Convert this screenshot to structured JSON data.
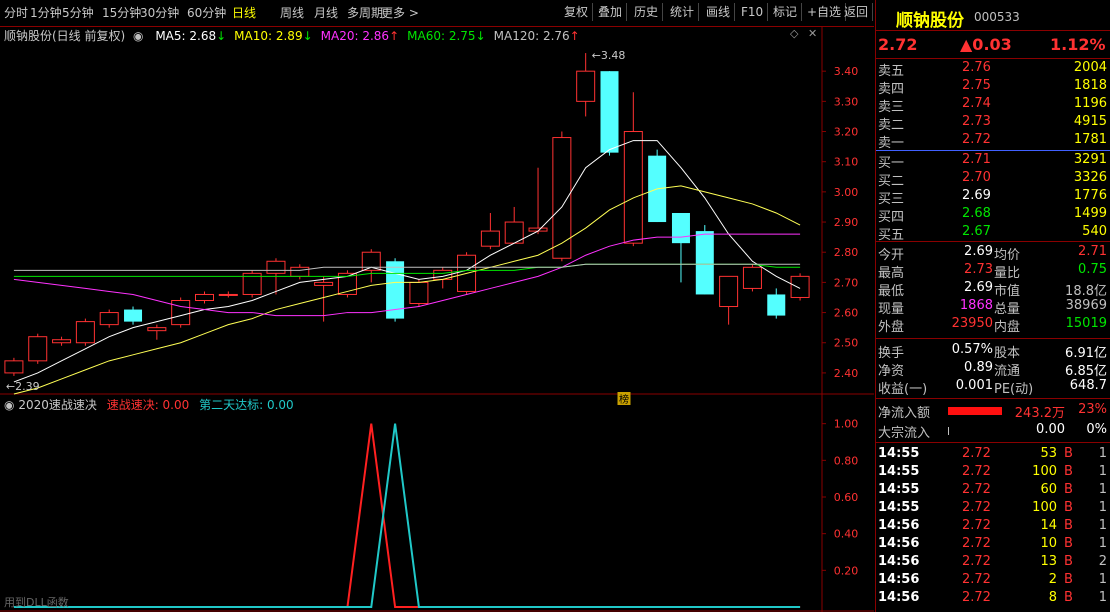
{
  "toolbar": {
    "left": [
      {
        "label": "分时",
        "active": false
      },
      {
        "label": "1分钟",
        "active": false
      },
      {
        "label": "5分钟",
        "active": false
      },
      {
        "label": "15分钟",
        "active": false
      },
      {
        "label": "30分钟",
        "active": false
      },
      {
        "label": "60分钟",
        "active": false
      },
      {
        "label": "日线",
        "active": true
      },
      {
        "label": "周线",
        "active": false
      },
      {
        "label": "月线",
        "active": false
      },
      {
        "label": "多周期",
        "active": false
      },
      {
        "label": "更多 >",
        "active": false
      }
    ],
    "right": [
      "复权",
      "叠加",
      "历史",
      "统计",
      "画线",
      "F10",
      "标记",
      "+自选",
      "返回"
    ]
  },
  "chart_header": {
    "title": "顺钠股份(日线 前复权)",
    "ma": [
      {
        "label": "MA5: 2.68",
        "arrow": "↓",
        "color": "#ffffff",
        "arrow_color": "#00e600"
      },
      {
        "label": "MA10: 2.89",
        "arrow": "↓",
        "color": "#ffff00",
        "arrow_color": "#00e600"
      },
      {
        "label": "MA20: 2.86",
        "arrow": "↑",
        "color": "#ff32ff",
        "arrow_color": "#ff3232"
      },
      {
        "label": "MA60: 2.75",
        "arrow": "↓",
        "color": "#00e600",
        "arrow_color": "#00e600"
      },
      {
        "label": "MA120: 2.76",
        "arrow": "↑",
        "color": "#c0c0c0",
        "arrow_color": "#ff3232"
      }
    ],
    "high_label": "3.48",
    "low_label": "2.39",
    "badge": "榜"
  },
  "indicator_header": {
    "name": "2020速战速决",
    "s1": "速战速决: 0.00",
    "s2": "第二天达标: 0.00",
    "footer": "用到DLL函数"
  },
  "chart_data": [
    {
      "type": "candlestick",
      "ylim": [
        2.35,
        3.5
      ],
      "yticks": [
        "3.40",
        "3.30",
        "3.20",
        "3.10",
        "3.00",
        "2.90",
        "2.80",
        "2.70",
        "2.60",
        "2.50",
        "2.40"
      ],
      "ytick_values": [
        3.4,
        3.3,
        3.2,
        3.1,
        3.0,
        2.9,
        2.8,
        2.7,
        2.6,
        2.5,
        2.4
      ],
      "candles": [
        {
          "o": 2.4,
          "c": 2.44,
          "h": 2.45,
          "l": 2.39
        },
        {
          "o": 2.44,
          "c": 2.52,
          "h": 2.53,
          "l": 2.43
        },
        {
          "o": 2.5,
          "c": 2.51,
          "h": 2.52,
          "l": 2.49
        },
        {
          "o": 2.5,
          "c": 2.57,
          "h": 2.58,
          "l": 2.49
        },
        {
          "o": 2.56,
          "c": 2.6,
          "h": 2.61,
          "l": 2.55
        },
        {
          "o": 2.61,
          "c": 2.57,
          "h": 2.62,
          "l": 2.56
        },
        {
          "o": 2.54,
          "c": 2.55,
          "h": 2.56,
          "l": 2.51
        },
        {
          "o": 2.56,
          "c": 2.64,
          "h": 2.65,
          "l": 2.55
        },
        {
          "o": 2.64,
          "c": 2.66,
          "h": 2.67,
          "l": 2.63
        },
        {
          "o": 2.66,
          "c": 2.66,
          "h": 2.67,
          "l": 2.65
        },
        {
          "o": 2.66,
          "c": 2.73,
          "h": 2.74,
          "l": 2.65
        },
        {
          "o": 2.73,
          "c": 2.77,
          "h": 2.78,
          "l": 2.66
        },
        {
          "o": 2.72,
          "c": 2.75,
          "h": 2.76,
          "l": 2.71
        },
        {
          "o": 2.69,
          "c": 2.7,
          "h": 2.72,
          "l": 2.57
        },
        {
          "o": 2.66,
          "c": 2.73,
          "h": 2.74,
          "l": 2.65
        },
        {
          "o": 2.74,
          "c": 2.8,
          "h": 2.81,
          "l": 2.7
        },
        {
          "o": 2.77,
          "c": 2.58,
          "h": 2.78,
          "l": 2.57
        },
        {
          "o": 2.63,
          "c": 2.7,
          "h": 2.71,
          "l": 2.62
        },
        {
          "o": 2.71,
          "c": 2.74,
          "h": 2.75,
          "l": 2.68
        },
        {
          "o": 2.67,
          "c": 2.79,
          "h": 2.8,
          "l": 2.66
        },
        {
          "o": 2.82,
          "c": 2.87,
          "h": 2.93,
          "l": 2.81
        },
        {
          "o": 2.83,
          "c": 2.9,
          "h": 2.95,
          "l": 2.83
        },
        {
          "o": 2.87,
          "c": 2.88,
          "h": 3.08,
          "l": 2.86
        },
        {
          "o": 2.78,
          "c": 3.18,
          "h": 3.2,
          "l": 2.77
        },
        {
          "o": 3.3,
          "c": 3.4,
          "h": 3.46,
          "l": 3.25
        },
        {
          "o": 3.4,
          "c": 3.13,
          "h": 3.4,
          "l": 3.12
        },
        {
          "o": 2.83,
          "c": 3.2,
          "h": 3.33,
          "l": 2.82
        },
        {
          "o": 3.12,
          "c": 2.9,
          "h": 3.14,
          "l": 2.9
        },
        {
          "o": 2.93,
          "c": 2.83,
          "h": 2.93,
          "l": 2.7
        },
        {
          "o": 2.87,
          "c": 2.66,
          "h": 2.89,
          "l": 2.66
        },
        {
          "o": 2.62,
          "c": 2.72,
          "h": 2.72,
          "l": 2.56
        },
        {
          "o": 2.68,
          "c": 2.75,
          "h": 2.76,
          "l": 2.67
        },
        {
          "o": 2.66,
          "c": 2.59,
          "h": 2.68,
          "l": 2.58
        },
        {
          "o": 2.65,
          "c": 2.72,
          "h": 2.73,
          "l": 2.64
        }
      ],
      "ma5": [
        2.37,
        2.4,
        2.44,
        2.48,
        2.52,
        2.55,
        2.57,
        2.59,
        2.61,
        2.62,
        2.64,
        2.67,
        2.7,
        2.71,
        2.72,
        2.75,
        2.73,
        2.71,
        2.72,
        2.74,
        2.79,
        2.83,
        2.87,
        2.95,
        3.08,
        3.14,
        3.17,
        3.17,
        3.08,
        2.98,
        2.86,
        2.77,
        2.72,
        2.68
      ],
      "ma10": [
        2.33,
        2.35,
        2.38,
        2.41,
        2.44,
        2.46,
        2.48,
        2.5,
        2.53,
        2.56,
        2.58,
        2.61,
        2.63,
        2.65,
        2.67,
        2.69,
        2.7,
        2.7,
        2.71,
        2.73,
        2.75,
        2.77,
        2.79,
        2.83,
        2.88,
        2.94,
        2.98,
        3.01,
        3.02,
        3.0,
        2.98,
        2.96,
        2.93,
        2.89
      ],
      "ma20": [
        2.71,
        2.7,
        2.69,
        2.68,
        2.67,
        2.66,
        2.64,
        2.62,
        2.61,
        2.6,
        2.6,
        2.59,
        2.59,
        2.59,
        2.6,
        2.6,
        2.61,
        2.62,
        2.64,
        2.66,
        2.68,
        2.7,
        2.72,
        2.75,
        2.79,
        2.82,
        2.84,
        2.85,
        2.85,
        2.86,
        2.86,
        2.86,
        2.86,
        2.86
      ],
      "ma60": [
        2.72,
        2.72,
        2.72,
        2.72,
        2.72,
        2.72,
        2.72,
        2.72,
        2.72,
        2.72,
        2.72,
        2.72,
        2.72,
        2.72,
        2.72,
        2.73,
        2.73,
        2.73,
        2.73,
        2.74,
        2.74,
        2.74,
        2.75,
        2.75,
        2.76,
        2.76,
        2.76,
        2.76,
        2.76,
        2.76,
        2.76,
        2.76,
        2.75,
        2.75
      ],
      "ma120": [
        2.74,
        2.74,
        2.74,
        2.74,
        2.74,
        2.74,
        2.74,
        2.74,
        2.74,
        2.74,
        2.74,
        2.74,
        2.74,
        2.75,
        2.75,
        2.75,
        2.75,
        2.75,
        2.75,
        2.75,
        2.75,
        2.75,
        2.75,
        2.75,
        2.76,
        2.76,
        2.76,
        2.76,
        2.76,
        2.76,
        2.76,
        2.76,
        2.76,
        2.76
      ]
    },
    {
      "type": "line",
      "ylim": [
        0,
        1.08
      ],
      "yticks": [
        "1.00",
        "0.80",
        "0.60",
        "0.40",
        "0.20"
      ],
      "ytick_values": [
        1.0,
        0.8,
        0.6,
        0.4,
        0.2
      ],
      "x": [
        0,
        1,
        2,
        3,
        4,
        5,
        6,
        7,
        8,
        9,
        10,
        11,
        12,
        13,
        14,
        15,
        16,
        17,
        18,
        19,
        20,
        21,
        22,
        23,
        24,
        25,
        26,
        27,
        28,
        29,
        30,
        31,
        32,
        33
      ],
      "series": [
        {
          "name": "速战速决",
          "color": "#ff2020",
          "values": [
            0,
            0,
            0,
            0,
            0,
            0,
            0,
            0,
            0,
            0,
            0,
            0,
            0,
            0,
            0,
            1,
            0,
            0,
            0,
            0,
            0,
            0,
            0,
            0,
            0,
            0,
            0,
            0,
            0,
            0,
            0,
            0,
            0,
            0
          ]
        },
        {
          "name": "第二天达标",
          "color": "#20c8c8",
          "values": [
            0,
            0,
            0,
            0,
            0,
            0,
            0,
            0,
            0,
            0,
            0,
            0,
            0,
            0,
            0,
            0,
            1,
            0,
            0,
            0,
            0,
            0,
            0,
            0,
            0,
            0,
            0,
            0,
            0,
            0,
            0,
            0,
            0,
            0
          ]
        }
      ]
    }
  ],
  "side": {
    "name": "顺钠股份",
    "code": "000533",
    "price": "2.72",
    "change": "▲0.03",
    "pct": "1.12%",
    "asks": [
      {
        "label": "卖五",
        "price": "2.76",
        "vol": "2004"
      },
      {
        "label": "卖四",
        "price": "2.75",
        "vol": "1818"
      },
      {
        "label": "卖三",
        "price": "2.74",
        "vol": "1196"
      },
      {
        "label": "卖二",
        "price": "2.73",
        "vol": "4915"
      },
      {
        "label": "卖一",
        "price": "2.72",
        "vol": "1781"
      }
    ],
    "bids": [
      {
        "label": "买一",
        "price": "2.71",
        "vol": "3291",
        "color": "red"
      },
      {
        "label": "买二",
        "price": "2.70",
        "vol": "3326",
        "color": "red"
      },
      {
        "label": "买三",
        "price": "2.69",
        "vol": "1776",
        "color": "white"
      },
      {
        "label": "买四",
        "price": "2.68",
        "vol": "1499",
        "color": "green"
      },
      {
        "label": "买五",
        "price": "2.67",
        "vol": "540",
        "color": "green"
      }
    ],
    "stats": [
      {
        "l1": "今开",
        "v1": "2.69",
        "c1": "white",
        "l2": "均价",
        "v2": "2.71",
        "c2": "red"
      },
      {
        "l1": "最高",
        "v1": "2.73",
        "c1": "red",
        "l2": "量比",
        "v2": "0.75",
        "c2": "green"
      },
      {
        "l1": "最低",
        "v1": "2.69",
        "c1": "white",
        "l2": "市值",
        "v2": "18.8亿",
        "c2": "gray"
      },
      {
        "l1": "现量",
        "v1": "1868",
        "c1": "mag",
        "l2": "总量",
        "v2": "38969",
        "c2": "gray"
      },
      {
        "l1": "外盘",
        "v1": "23950",
        "c1": "red",
        "l2": "内盘",
        "v2": "15019",
        "c2": "green"
      }
    ],
    "fin": [
      {
        "l1": "换手",
        "v1": "0.57%",
        "l2": "股本",
        "v2": "6.91亿"
      },
      {
        "l1": "净资",
        "v1": "0.89",
        "l2": "流通",
        "v2": "6.85亿"
      },
      {
        "l1": "收益(一)",
        "v1": "0.001",
        "l2": "PE(动)",
        "v2": "648.7"
      }
    ],
    "flow": [
      {
        "label": "净流入额",
        "value": "243.2万",
        "pct": "23%",
        "bar": 0.6,
        "color": "red"
      },
      {
        "label": "大宗流入",
        "value": "0.00",
        "pct": "0%",
        "bar": 0.0,
        "color": "white"
      }
    ],
    "ticks": [
      {
        "t": "14:55",
        "p": "2.72",
        "v": "53",
        "b": "B",
        "n": "1"
      },
      {
        "t": "14:55",
        "p": "2.72",
        "v": "100",
        "b": "B",
        "n": "1"
      },
      {
        "t": "14:55",
        "p": "2.72",
        "v": "60",
        "b": "B",
        "n": "1"
      },
      {
        "t": "14:55",
        "p": "2.72",
        "v": "100",
        "b": "B",
        "n": "1"
      },
      {
        "t": "14:56",
        "p": "2.72",
        "v": "14",
        "b": "B",
        "n": "1"
      },
      {
        "t": "14:56",
        "p": "2.72",
        "v": "10",
        "b": "B",
        "n": "1"
      },
      {
        "t": "14:56",
        "p": "2.72",
        "v": "13",
        "b": "B",
        "n": "2"
      },
      {
        "t": "14:56",
        "p": "2.72",
        "v": "2",
        "b": "B",
        "n": "1"
      },
      {
        "t": "14:56",
        "p": "2.72",
        "v": "8",
        "b": "B",
        "n": "1"
      }
    ]
  }
}
